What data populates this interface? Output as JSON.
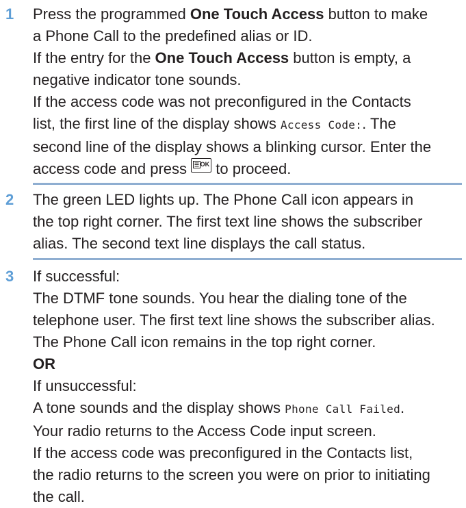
{
  "steps": [
    {
      "number": "1",
      "lines": {
        "l1_pre": "Press the programmed ",
        "l1_bold": "One Touch Access",
        "l1_post": " button to make",
        "l2": "a Phone Call to the predefined alias or ID.",
        "l3_pre": "If the entry for the ",
        "l3_bold": "One Touch Access",
        "l3_post": " button is empty, a",
        "l4": "negative indicator tone sounds.",
        "l5": "If the access code was not preconfigured in the Contacts",
        "l6_pre": "list, the first line of the display shows ",
        "l6_mono": "Access Code:",
        "l6_post": ". The",
        "l7": "second line of the display shows a blinking cursor. Enter the",
        "l8_pre": "access code and press ",
        "l8_key": "OK",
        "l8_post": " to proceed."
      }
    },
    {
      "number": "2",
      "lines": {
        "l1": "The green LED lights up. The Phone Call icon appears in",
        "l2": "the top right corner. The first text line shows the subscriber",
        "l3": "alias. The second text line displays the call status."
      }
    },
    {
      "number": "3",
      "lines": {
        "l1": "If successful:",
        "l2": "The DTMF tone sounds. You hear the dialing tone of the",
        "l3": "telephone user. The first text line shows the subscriber alias.",
        "l4": "The Phone Call icon remains in the top right corner.",
        "l5": "OR",
        "l6": "If unsuccessful:",
        "l7_pre": "A tone sounds and the display shows ",
        "l7_mono": "Phone Call Failed",
        "l7_post": ".",
        "l8": "Your radio returns to the Access Code input screen.",
        "l9": "If the access code was preconfigured in the Contacts list,",
        "l10": "the radio returns to the screen you were on prior to initiating",
        "l11": "the call."
      }
    }
  ],
  "colors": {
    "step_number": "#5e9ed6",
    "divider": "#8faed1",
    "text": "#231f20"
  },
  "icons": {
    "ok_key": "menu-ok-key-icon"
  }
}
